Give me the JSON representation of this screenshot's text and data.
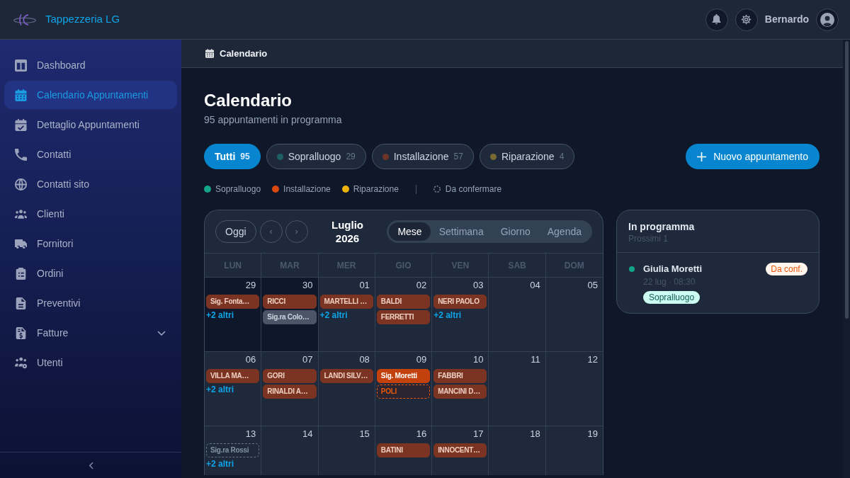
{
  "app": {
    "name": "Tappezzeria LG"
  },
  "header": {
    "user_name": "Bernardo"
  },
  "sidebar": {
    "items": [
      {
        "label": "Dashboard",
        "kind": "link",
        "selected": false
      },
      {
        "label": "Calendario Appuntamenti",
        "kind": "link",
        "selected": true
      },
      {
        "label": "Dettaglio Appuntamenti",
        "kind": "link",
        "selected": false
      },
      {
        "label": "Contatti",
        "kind": "link",
        "selected": false
      },
      {
        "label": "Contatti sito",
        "kind": "link",
        "selected": false
      },
      {
        "label": "Clienti",
        "kind": "link",
        "selected": false
      },
      {
        "label": "Fornitori",
        "kind": "link",
        "selected": false
      },
      {
        "label": "Ordini",
        "kind": "link",
        "selected": false
      },
      {
        "label": "Preventivi",
        "kind": "link",
        "selected": false
      },
      {
        "label": "Fatture",
        "kind": "group",
        "selected": false,
        "expanded": false
      },
      {
        "label": "Utenti",
        "kind": "link",
        "selected": false
      }
    ]
  },
  "breadcrumb": {
    "label": "Calendario"
  },
  "page": {
    "title": "Calendario",
    "subtitle": "95 appuntamenti in programma"
  },
  "filters": [
    {
      "label": "Tutti",
      "count": "95",
      "selected": true
    },
    {
      "label": "Sopralluogo",
      "count": "29",
      "selected": false,
      "color": "#1d5f63"
    },
    {
      "label": "Installazione",
      "count": "57",
      "selected": false,
      "color": "#6e3426"
    },
    {
      "label": "Riparazione",
      "count": "4",
      "selected": false,
      "color": "#776a30"
    }
  ],
  "new_button": {
    "label": "Nuovo appuntamento"
  },
  "legend": {
    "items": [
      {
        "label": "Sopralluogo",
        "color": "#14a38b"
      },
      {
        "label": "Installazione",
        "color": "#d9480f"
      },
      {
        "label": "Riparazione",
        "color": "#eab308"
      }
    ],
    "pending_label": "Da confermare"
  },
  "calendar": {
    "today_button": "Oggi",
    "prev": "‹",
    "next": "›",
    "month_title": "Luglio 2026",
    "views": [
      {
        "label": "Mese",
        "selected": true
      },
      {
        "label": "Settimana",
        "selected": false
      },
      {
        "label": "Giorno",
        "selected": false
      },
      {
        "label": "Agenda",
        "selected": false
      }
    ],
    "weekdays": [
      "LUN",
      "MAR",
      "MER",
      "GIO",
      "VEN",
      "SAB",
      "DOM"
    ],
    "weeks": [
      {
        "days": [
          {
            "day": "29",
            "in_month": false,
            "events": [
              {
                "label": "Sig. Fonta…",
                "kind": "filled",
                "confirmed": true
              }
            ],
            "more": "+2 altri"
          },
          {
            "day": "30",
            "in_month": false,
            "events": [
              {
                "label": "RICCI",
                "kind": "filled",
                "confirmed": true
              },
              {
                "label": "Sig.ra Colo…",
                "kind": "muted",
                "confirmed": true
              }
            ]
          },
          {
            "day": "01",
            "in_month": true,
            "events": [
              {
                "label": "MARTELLI …",
                "kind": "filled",
                "confirmed": true
              }
            ],
            "more": "+2 altri"
          },
          {
            "day": "02",
            "in_month": true,
            "events": [
              {
                "label": "BALDI",
                "kind": "filled",
                "confirmed": true
              },
              {
                "label": "FERRETTI",
                "kind": "filled",
                "confirmed": true
              }
            ]
          },
          {
            "day": "03",
            "in_month": true,
            "events": [
              {
                "label": "NERI PAOLO",
                "kind": "filled",
                "confirmed": true
              }
            ],
            "more": "+2 altri"
          },
          {
            "day": "04",
            "in_month": true
          },
          {
            "day": "05",
            "in_month": true
          }
        ]
      },
      {
        "days": [
          {
            "day": "06",
            "in_month": true,
            "events": [
              {
                "label": "VILLA MA…",
                "kind": "filled",
                "confirmed": true
              }
            ],
            "more": "+2 altri"
          },
          {
            "day": "07",
            "in_month": true,
            "events": [
              {
                "label": "GORI",
                "kind": "filled",
                "confirmed": true
              },
              {
                "label": "RINALDI A…",
                "kind": "filled",
                "confirmed": true
              }
            ]
          },
          {
            "day": "08",
            "in_month": true,
            "events": [
              {
                "label": "LANDI SILV…",
                "kind": "filled",
                "confirmed": true
              }
            ]
          },
          {
            "day": "09",
            "in_month": true,
            "events": [
              {
                "label": "Sig. Moretti",
                "kind": "highlight",
                "confirmed": true
              },
              {
                "label": "POLI",
                "kind": "filled",
                "confirmed": false
              }
            ]
          },
          {
            "day": "10",
            "in_month": true,
            "events": [
              {
                "label": "FABBRI",
                "kind": "filled",
                "confirmed": true
              },
              {
                "label": "MANCINI D…",
                "kind": "filled",
                "confirmed": true
              }
            ]
          },
          {
            "day": "11",
            "in_month": true
          },
          {
            "day": "12",
            "in_month": true
          }
        ]
      },
      {
        "days": [
          {
            "day": "13",
            "in_month": true,
            "events": [
              {
                "label": "Sig.ra Rossi",
                "kind": "muted",
                "confirmed": false
              }
            ],
            "more": "+2 altri"
          },
          {
            "day": "14",
            "in_month": true
          },
          {
            "day": "15",
            "in_month": true
          },
          {
            "day": "16",
            "in_month": true,
            "events": [
              {
                "label": "BATINI",
                "kind": "filled",
                "confirmed": true
              }
            ]
          },
          {
            "day": "17",
            "in_month": true,
            "events": [
              {
                "label": "INNOCENT…",
                "kind": "filled",
                "confirmed": true
              }
            ]
          },
          {
            "day": "18",
            "in_month": true
          },
          {
            "day": "19",
            "in_month": true
          }
        ]
      }
    ]
  },
  "upcoming": {
    "title": "In programma",
    "subtitle": "Prossimi 1",
    "items": [
      {
        "name": "Giulia Moretti",
        "when": "22 lug · 08:30",
        "type": "Sopralluogo",
        "badge": "Da conf.",
        "color": "#14a38b"
      }
    ]
  }
}
